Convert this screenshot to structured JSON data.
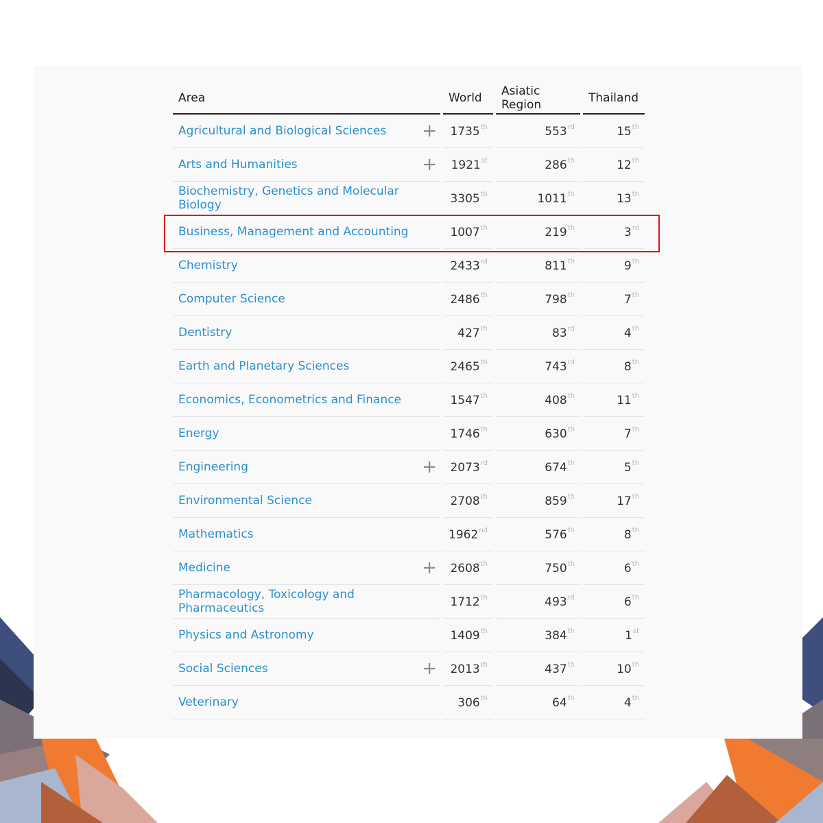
{
  "table": {
    "headers": {
      "area": "Area",
      "world": "World",
      "asia": "Asiatic Region",
      "thailand": "Thailand"
    },
    "rows": [
      {
        "area": "Agricultural and Biological Sciences",
        "expandable": true,
        "world": "1735",
        "world_suffix": "th",
        "asia": "553",
        "asia_suffix": "rd",
        "thailand": "15",
        "thailand_suffix": "th"
      },
      {
        "area": "Arts and Humanities",
        "expandable": true,
        "world": "1921",
        "world_suffix": "st",
        "asia": "286",
        "asia_suffix": "th",
        "thailand": "12",
        "thailand_suffix": "th"
      },
      {
        "area": "Biochemistry, Genetics and Molecular Biology",
        "expandable": false,
        "world": "3305",
        "world_suffix": "th",
        "asia": "1011",
        "asia_suffix": "th",
        "thailand": "13",
        "thailand_suffix": "th"
      },
      {
        "area": "Business, Management and Accounting",
        "expandable": false,
        "highlighted": true,
        "world": "1007",
        "world_suffix": "th",
        "asia": "219",
        "asia_suffix": "th",
        "thailand": "3",
        "thailand_suffix": "rd"
      },
      {
        "area": "Chemistry",
        "expandable": false,
        "world": "2433",
        "world_suffix": "rd",
        "asia": "811",
        "asia_suffix": "th",
        "thailand": "9",
        "thailand_suffix": "th"
      },
      {
        "area": "Computer Science",
        "expandable": false,
        "world": "2486",
        "world_suffix": "th",
        "asia": "798",
        "asia_suffix": "th",
        "thailand": "7",
        "thailand_suffix": "th"
      },
      {
        "area": "Dentistry",
        "expandable": false,
        "world": "427",
        "world_suffix": "th",
        "asia": "83",
        "asia_suffix": "rd",
        "thailand": "4",
        "thailand_suffix": "th"
      },
      {
        "area": "Earth and Planetary Sciences",
        "expandable": false,
        "world": "2465",
        "world_suffix": "th",
        "asia": "743",
        "asia_suffix": "rd",
        "thailand": "8",
        "thailand_suffix": "th"
      },
      {
        "area": "Economics, Econometrics and Finance",
        "expandable": false,
        "world": "1547",
        "world_suffix": "th",
        "asia": "408",
        "asia_suffix": "th",
        "thailand": "11",
        "thailand_suffix": "th"
      },
      {
        "area": "Energy",
        "expandable": false,
        "world": "1746",
        "world_suffix": "th",
        "asia": "630",
        "asia_suffix": "th",
        "thailand": "7",
        "thailand_suffix": "th"
      },
      {
        "area": "Engineering",
        "expandable": true,
        "world": "2073",
        "world_suffix": "rd",
        "asia": "674",
        "asia_suffix": "th",
        "thailand": "5",
        "thailand_suffix": "th"
      },
      {
        "area": "Environmental Science",
        "expandable": false,
        "world": "2708",
        "world_suffix": "th",
        "asia": "859",
        "asia_suffix": "th",
        "thailand": "17",
        "thailand_suffix": "th"
      },
      {
        "area": "Mathematics",
        "expandable": false,
        "world": "1962",
        "world_suffix": "nd",
        "asia": "576",
        "asia_suffix": "th",
        "thailand": "8",
        "thailand_suffix": "th"
      },
      {
        "area": "Medicine",
        "expandable": true,
        "world": "2608",
        "world_suffix": "th",
        "asia": "750",
        "asia_suffix": "th",
        "thailand": "6",
        "thailand_suffix": "th"
      },
      {
        "area": "Pharmacology, Toxicology and Pharmaceutics",
        "expandable": false,
        "world": "1712",
        "world_suffix": "th",
        "asia": "493",
        "asia_suffix": "rd",
        "thailand": "6",
        "thailand_suffix": "th"
      },
      {
        "area": "Physics and Astronomy",
        "expandable": false,
        "world": "1409",
        "world_suffix": "th",
        "asia": "384",
        "asia_suffix": "th",
        "thailand": "1",
        "thailand_suffix": "st"
      },
      {
        "area": "Social Sciences",
        "expandable": true,
        "world": "2013",
        "world_suffix": "th",
        "asia": "437",
        "asia_suffix": "th",
        "thailand": "10",
        "thailand_suffix": "th"
      },
      {
        "area": "Veterinary",
        "expandable": false,
        "world": "306",
        "world_suffix": "th",
        "asia": "64",
        "asia_suffix": "th",
        "thailand": "4",
        "thailand_suffix": "th"
      }
    ]
  },
  "icons": {
    "expand": "plus-icon"
  },
  "colors": {
    "link": "#2a8fd0",
    "highlight_border": "#e0141b",
    "panel_bg": "#f9f9f9",
    "deco_navy": "#2e3a5c",
    "deco_orange": "#ee7a2f"
  },
  "glyphs": {
    "plus": "+"
  }
}
